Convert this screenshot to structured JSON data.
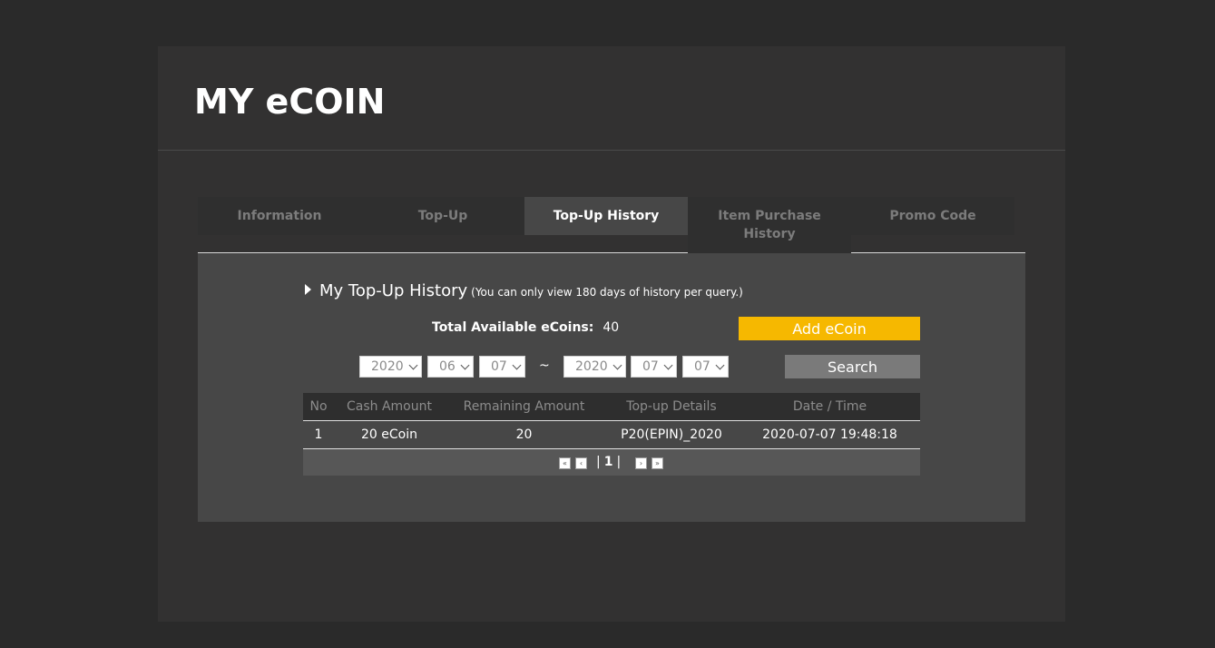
{
  "header": {
    "title": "MY eCOIN"
  },
  "tabs": [
    {
      "label": "Information"
    },
    {
      "label": "Top-Up"
    },
    {
      "label": "Top-Up History"
    },
    {
      "label": "Item Purchase History"
    },
    {
      "label": "Promo Code"
    }
  ],
  "section": {
    "title": "My Top-Up History",
    "note": "(You can only view 180 days of history per query.)"
  },
  "balance": {
    "label": "Total Available eCoins:",
    "value": "40"
  },
  "buttons": {
    "add": "Add eCoin",
    "search": "Search"
  },
  "date_from": {
    "year": "2020",
    "month": "06",
    "day": "07"
  },
  "date_separator": "~",
  "date_to": {
    "year": "2020",
    "month": "07",
    "day": "07"
  },
  "table": {
    "headers": [
      "No",
      "Cash Amount",
      "Remaining Amount",
      "Top-up Details",
      "Date / Time"
    ],
    "rows": [
      [
        "1",
        "20 eCoin",
        "20",
        "P20(EPIN)_2020",
        "2020-07-07 19:48:18"
      ]
    ]
  },
  "pagination": {
    "current": "1",
    "separator": "|"
  },
  "colors": {
    "accent": "#f6b800",
    "panel": "#323131",
    "content": "#474747"
  }
}
